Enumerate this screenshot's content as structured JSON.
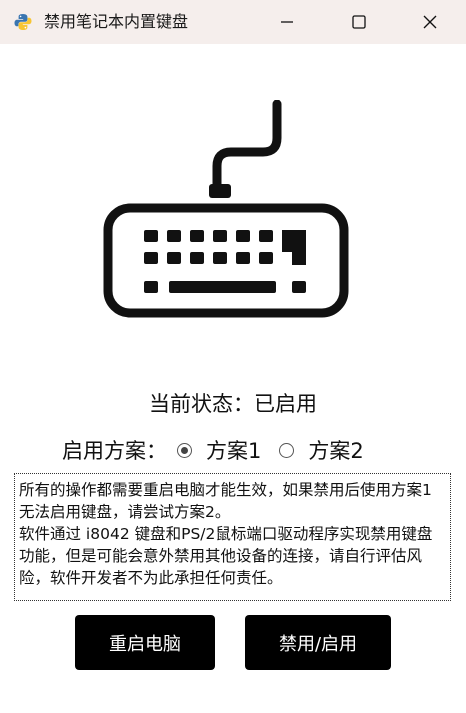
{
  "window": {
    "title": "禁用笔记本内置键盘",
    "icon": "python-icon"
  },
  "status": {
    "text": "当前状态：已启用"
  },
  "scheme": {
    "label": "启用方案：",
    "options": [
      {
        "label": "方案1",
        "selected": true
      },
      {
        "label": "方案2",
        "selected": false
      }
    ]
  },
  "notice": {
    "paragraph1": "所有的操作都需要重启电脑才能生效，如果禁用后使用方案1无法启用键盘，请尝试方案2。",
    "paragraph2": "软件通过 i8042 键盘和PS/2鼠标端口驱动程序实现禁用键盘功能，但是可能会意外禁用其他设备的连接，请自行评估风险，软件开发者不为此承担任何责任。"
  },
  "buttons": {
    "restart": "重启电脑",
    "toggle": "禁用/启用"
  },
  "colors": {
    "titlebar": "#f5eeec",
    "button_bg": "#000000",
    "button_text": "#ffffff"
  }
}
